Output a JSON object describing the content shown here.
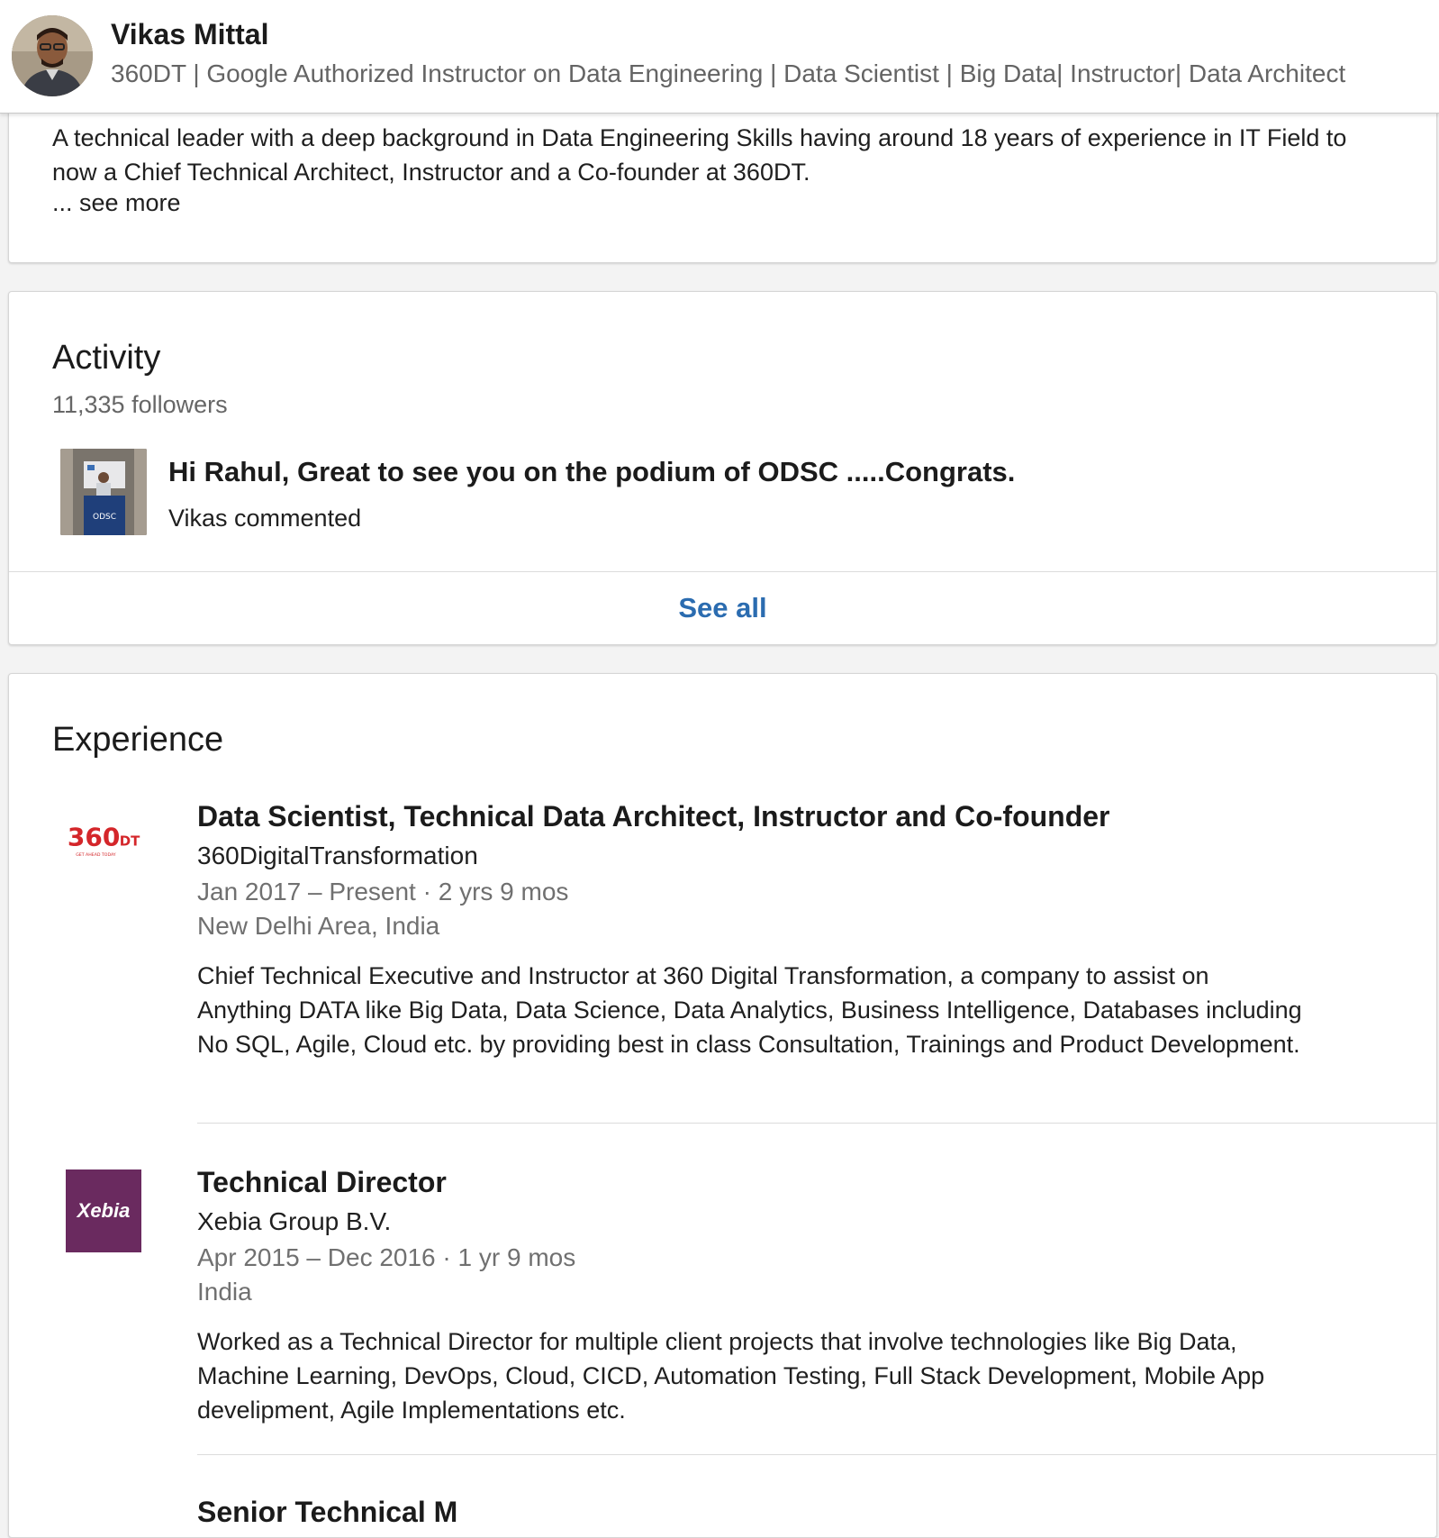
{
  "header": {
    "name": "Vikas Mittal",
    "headline": "360DT | Google Authorized Instructor on Data Engineering | Data Scientist | Big Data| Instructor| Data Architect"
  },
  "about": {
    "text": "A technical leader with a deep background in Data Engineering Skills having around 18 years of experience in IT Field to now a Chief Technical Architect, Instructor and a Co-founder at 360DT.",
    "see_more": "... see more"
  },
  "activity": {
    "title": "Activity",
    "followers": "11,335 followers",
    "post": {
      "headline": "Hi Rahul, Great to see you on the podium of ODSC .....Congrats.",
      "meta": "Vikas commented"
    },
    "see_all": "See all"
  },
  "experience": {
    "title": "Experience",
    "items": [
      {
        "title": "Data Scientist, Technical Data Architect, Instructor and Co-founder",
        "company": "360DigitalTransformation",
        "dates": "Jan 2017 – Present · 2 yrs 9 mos",
        "location": "New Delhi Area, India",
        "description": "Chief Technical Executive and Instructor at 360 Digital Transformation, a company to assist on Anything DATA like Big Data, Data Science, Data Analytics, Business Intelligence, Databases including No SQL, Agile, Cloud etc. by providing best in class Consultation, Trainings and Product Development.",
        "logo": {
          "text": "360DT",
          "tagline": "GET AHEAD TODAY",
          "color": "#d4262a"
        }
      },
      {
        "title": "Technical Director",
        "company": "Xebia Group B.V.",
        "dates": "Apr 2015 – Dec 2016 · 1 yr 9 mos",
        "location": "India",
        "description": "Worked as a Technical Director for multiple client projects that involve technologies like Big Data, Machine Learning, DevOps, Cloud, CICD, Automation Testing, Full Stack Development, Mobile App develipment, Agile Implementations etc.",
        "logo": {
          "text": "Xebia",
          "color": "#6a2a5f"
        }
      },
      {
        "title": "Senior Technical M"
      }
    ]
  },
  "colors": {
    "accent_link": "#2b6cb0",
    "muted_text": "#707070",
    "background": "#f3f3f3"
  }
}
